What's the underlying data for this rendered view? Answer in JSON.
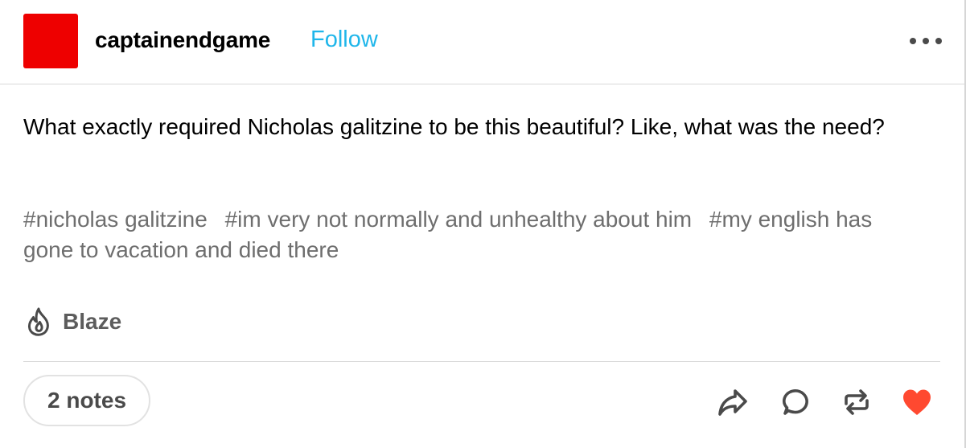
{
  "header": {
    "username": "captainendgame",
    "follow_label": "Follow"
  },
  "post": {
    "body": "What exactly required Nicholas galitzine to be this beautiful? Like, what was the need?",
    "tags": [
      "#nicholas galitzine",
      "#im very not normally and unhealthy about him",
      "#my english has gone to vacation and died there"
    ]
  },
  "footer": {
    "blaze_label": "Blaze",
    "notes_label": "2 notes"
  },
  "colors": {
    "avatar": "#ee0000",
    "follow": "#1fb6ea",
    "tag": "#6e6e6e",
    "icon": "#4a4a4a",
    "like": "#ff4930"
  },
  "icons": {
    "more": "ellipsis-icon",
    "blaze": "flame-icon",
    "share": "share-arrow-icon",
    "reply": "reply-bubble-icon",
    "reblog": "reblog-icon",
    "like": "heart-icon"
  }
}
